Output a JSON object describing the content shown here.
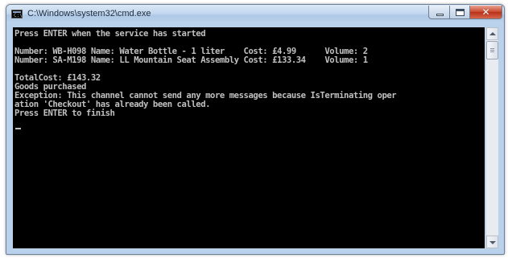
{
  "window": {
    "title": "C:\\Windows\\system32\\cmd.exe",
    "icon": "console-icon",
    "icon_label": "C:\\",
    "controls": {
      "minimize": "minimize-icon",
      "maximize": "maximize-icon",
      "close": "close-icon",
      "close_glyph": "✕"
    }
  },
  "console": {
    "lines": [
      "Press ENTER when the service has started",
      "",
      "Number: WB-H098 Name: Water Bottle - 1 liter    Cost: £4.99      Volume: 2",
      "Number: SA-M198 Name: LL Mountain Seat Assembly Cost: £133.34    Volume: 1",
      "",
      "TotalCost: £143.32",
      "Goods purchased",
      "Exception: This channel cannot send any more messages because IsTerminating oper",
      "ation 'Checkout' has already been called.",
      "Press ENTER to finish"
    ],
    "cursor": "_"
  },
  "colors": {
    "console_background": "#000000",
    "console_text": "#c0c0c0",
    "close_button": "#c9452b"
  }
}
